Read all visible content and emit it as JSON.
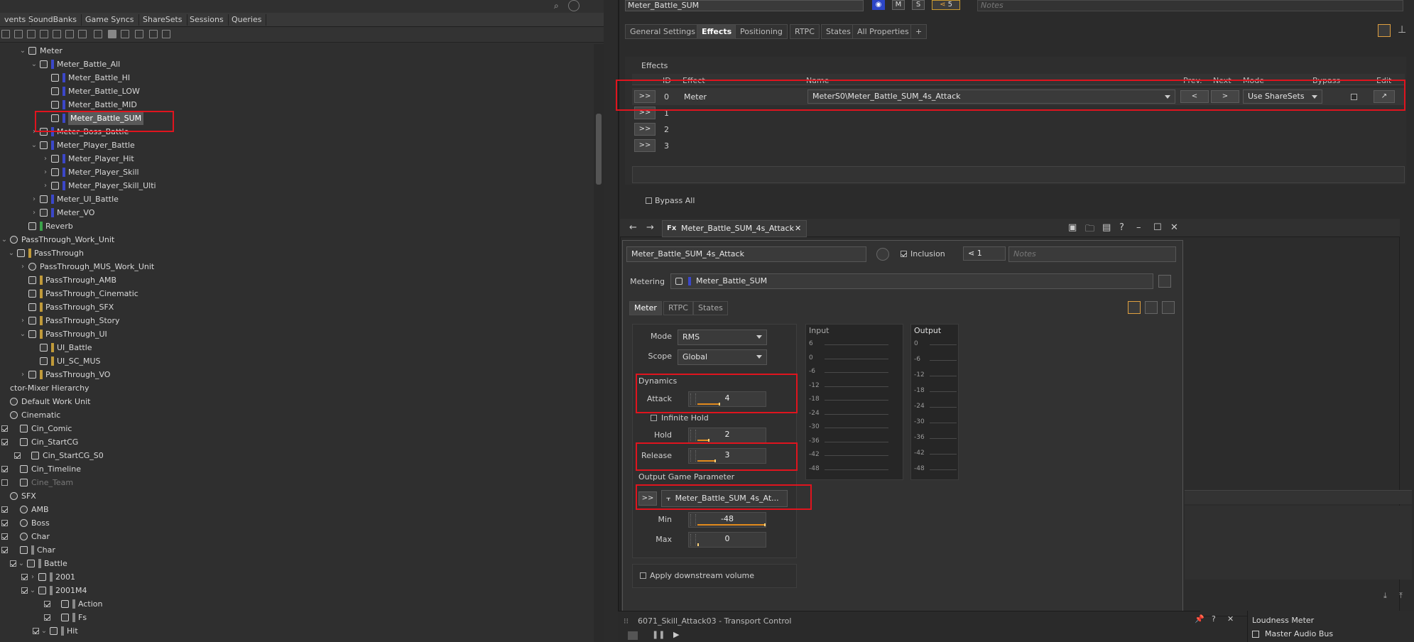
{
  "left_tabs": [
    "vents",
    "SoundBanks",
    "Game Syncs",
    "ShareSets",
    "Sessions",
    "Queries"
  ],
  "tree": [
    {
      "x": 26,
      "chev": "v",
      "icon": "bus",
      "label": "Meter",
      "bar": ""
    },
    {
      "x": 42,
      "chev": "v",
      "icon": "bus",
      "label": "Meter_Battle_All",
      "bar": "#3b47c9"
    },
    {
      "x": 58,
      "chev": "",
      "icon": "bus",
      "label": "Meter_Battle_HI",
      "bar": "#3b47c9"
    },
    {
      "x": 58,
      "chev": "",
      "icon": "bus",
      "label": "Meter_Battle_LOW",
      "bar": "#3b47c9"
    },
    {
      "x": 58,
      "chev": "",
      "icon": "bus",
      "label": "Meter_Battle_MID",
      "bar": "#3b47c9"
    },
    {
      "x": 58,
      "chev": "",
      "icon": "bus",
      "label": "Meter_Battle_SUM",
      "bar": "#3b47c9",
      "selected": true
    },
    {
      "x": 42,
      "chev": ">",
      "icon": "bus",
      "label": "Meter_Boss_Battle",
      "bar": "#3b47c9"
    },
    {
      "x": 42,
      "chev": "v",
      "icon": "bus",
      "label": "Meter_Player_Battle",
      "bar": "#3b47c9"
    },
    {
      "x": 58,
      "chev": ">",
      "icon": "bus",
      "label": "Meter_Player_Hit",
      "bar": "#3b47c9"
    },
    {
      "x": 58,
      "chev": ">",
      "icon": "bus",
      "label": "Meter_Player_Skill",
      "bar": "#3b47c9"
    },
    {
      "x": 58,
      "chev": ">",
      "icon": "bus",
      "label": "Meter_Player_Skill_Ulti",
      "bar": "#3b47c9"
    },
    {
      "x": 42,
      "chev": ">",
      "icon": "bus",
      "label": "Meter_UI_Battle",
      "bar": "#3b47c9"
    },
    {
      "x": 42,
      "chev": ">",
      "icon": "bus",
      "label": "Meter_VO",
      "bar": "#3b47c9"
    },
    {
      "x": 26,
      "chev": "",
      "icon": "bus",
      "label": "Reverb",
      "bar": "#3aa34a"
    },
    {
      "x": 0,
      "chev": "v",
      "icon": "wu",
      "label": "PassThrough_Work_Unit",
      "bar": ""
    },
    {
      "x": 10,
      "chev": "v",
      "icon": "bus",
      "label": "PassThrough",
      "bar": "#c09a3a"
    },
    {
      "x": 26,
      "chev": ">",
      "icon": "wu",
      "label": "PassThrough_MUS_Work_Unit",
      "bar": ""
    },
    {
      "x": 26,
      "chev": "",
      "icon": "bus",
      "label": "PassThrough_AMB",
      "bar": "#c09a3a"
    },
    {
      "x": 26,
      "chev": "",
      "icon": "bus",
      "label": "PassThrough_Cinematic",
      "bar": "#c09a3a"
    },
    {
      "x": 26,
      "chev": "",
      "icon": "bus",
      "label": "PassThrough_SFX",
      "bar": "#c09a3a"
    },
    {
      "x": 26,
      "chev": ">",
      "icon": "bus",
      "label": "PassThrough_Story",
      "bar": "#c09a3a"
    },
    {
      "x": 26,
      "chev": "v",
      "icon": "bus",
      "label": "PassThrough_UI",
      "bar": "#c09a3a"
    },
    {
      "x": 42,
      "chev": "",
      "icon": "bus",
      "label": "UI_Battle",
      "bar": "#c09a3a"
    },
    {
      "x": 42,
      "chev": "",
      "icon": "bus",
      "label": "UI_SC_MUS",
      "bar": "#c09a3a"
    },
    {
      "x": 26,
      "chev": ">",
      "icon": "bus",
      "label": "PassThrough_VO",
      "bar": "#c09a3a"
    },
    {
      "x": 0,
      "chev": "",
      "icon": "",
      "label": "ctor-Mixer Hierarchy",
      "bar": ""
    },
    {
      "x": 0,
      "chev": "",
      "icon": "wu",
      "label": "Default Work Unit",
      "bar": ""
    },
    {
      "x": 0,
      "chev": "",
      "icon": "wu",
      "label": "Cinematic",
      "bar": ""
    },
    {
      "x": 0,
      "chev": "",
      "icon": "mix",
      "label": "Cin_Comic",
      "bar": "",
      "cb": true
    },
    {
      "x": 0,
      "chev": "",
      "icon": "mix",
      "label": "Cin_StartCG",
      "bar": "",
      "cb": true
    },
    {
      "x": 16,
      "chev": "",
      "icon": "mix",
      "label": "Cin_StartCG_S0",
      "bar": "",
      "cb": true
    },
    {
      "x": 0,
      "chev": "",
      "icon": "mix",
      "label": "Cin_Timeline",
      "bar": "",
      "cb": true
    },
    {
      "x": 0,
      "chev": "",
      "icon": "mix",
      "label": "Cine_Team",
      "bar": "",
      "cb": false,
      "dim": true
    },
    {
      "x": 0,
      "chev": "",
      "icon": "wu",
      "label": "SFX",
      "bar": ""
    },
    {
      "x": 0,
      "chev": "",
      "icon": "wu",
      "label": "AMB",
      "bar": "",
      "cb": true
    },
    {
      "x": 0,
      "chev": "",
      "icon": "wu",
      "label": "Boss",
      "bar": "",
      "cb": true
    },
    {
      "x": 0,
      "chev": "",
      "icon": "wu",
      "label": "Char",
      "bar": "",
      "cb": true
    },
    {
      "x": 0,
      "chev": "",
      "icon": "mix",
      "label": "Char",
      "bar": "#888",
      "cb": true
    },
    {
      "x": 10,
      "chev": "v",
      "icon": "mix",
      "label": "Battle",
      "bar": "#888",
      "cb": true
    },
    {
      "x": 26,
      "chev": ">",
      "icon": "mix",
      "label": "2001",
      "bar": "#888",
      "cb": true
    },
    {
      "x": 26,
      "chev": "v",
      "icon": "mix",
      "label": "2001M4",
      "bar": "#888",
      "cb": true
    },
    {
      "x": 58,
      "chev": "",
      "icon": "mix",
      "label": "Action",
      "bar": "#888",
      "cb": true
    },
    {
      "x": 58,
      "chev": "",
      "icon": "mix",
      "label": "Fs",
      "bar": "#888",
      "cb": true
    },
    {
      "x": 42,
      "chev": "v",
      "icon": "mix",
      "label": "Hit",
      "bar": "#888",
      "cb": true
    }
  ],
  "header": {
    "object_name": "Meter_Battle_SUM",
    "mute_label": "M",
    "solo_label": "S",
    "ref_count": "5",
    "notes_placeholder": "Notes"
  },
  "property_tabs": [
    "General Settings",
    "Effects",
    "Positioning",
    "RTPC",
    "States",
    "All Properties",
    "+"
  ],
  "effects": {
    "title": "Effects",
    "columns": {
      "id": "ID",
      "effect": "Effect",
      "name": "Name",
      "prev": "Prev.",
      "next": "Next",
      "mode": "Mode",
      "bypass": "Bypass",
      "edit": "Edit"
    },
    "rows": [
      {
        "go": ">>",
        "id": "0",
        "effect": "Meter",
        "name": "MeterS0\\Meter_Battle_SUM_4s_Attack",
        "prev": "<",
        "next": ">",
        "mode": "Use ShareSets"
      },
      {
        "go": ">>",
        "id": "1"
      },
      {
        "go": ">>",
        "id": "2"
      },
      {
        "go": ">>",
        "id": "3"
      }
    ],
    "bypass_all": "Bypass All"
  },
  "fx_editor": {
    "tab_icon": "Fx",
    "tab_title": "Meter_Battle_SUM_4s_Attack",
    "name_value": "Meter_Battle_SUM_4s_Attack",
    "inclusion_label": "Inclusion",
    "ref_count": "1",
    "notes_placeholder": "Notes",
    "metering_label": "Metering",
    "metering_value": "Meter_Battle_SUM",
    "subtabs": [
      "Meter",
      "RTPC",
      "States"
    ],
    "mode_label": "Mode",
    "mode_value": "RMS",
    "scope_label": "Scope",
    "scope_value": "Global",
    "dynamics_label": "Dynamics",
    "attack_label": "Attack",
    "attack_value": "4",
    "attack_fill": 0.32,
    "infinite_hold_label": "Infinite Hold",
    "hold_label": "Hold",
    "hold_value": "2",
    "hold_fill": 0.16,
    "release_label": "Release",
    "release_value": "3",
    "release_fill": 0.25,
    "output_gp_label": "Output Game Parameter",
    "output_gp_go": ">>",
    "output_gp_value": "Meter_Battle_SUM_4s_At...",
    "min_label": "Min",
    "min_value": "-48",
    "min_fill": 1.0,
    "max_label": "Max",
    "max_value": "0",
    "max_fill": 0.0,
    "apply_downstream_label": "Apply downstream volume",
    "input_label": "Input",
    "input_ticks": [
      "6",
      "0",
      "-6",
      "-12",
      "-18",
      "-24",
      "-30",
      "-36",
      "-42",
      "-48"
    ],
    "output_label": "Output",
    "output_ticks": [
      "0",
      "-6",
      "-12",
      "-18",
      "-24",
      "-30",
      "-36",
      "-42",
      "-48"
    ]
  },
  "transport": {
    "title": "6071_Skill_Attack03 - Transport Control"
  },
  "loudness": {
    "title": "Loudness Meter",
    "bus": "Master Audio Bus"
  },
  "colors": {
    "accent": "#e28a1c",
    "highlight": "#e0141e",
    "bus_blue": "#3b47c9"
  }
}
